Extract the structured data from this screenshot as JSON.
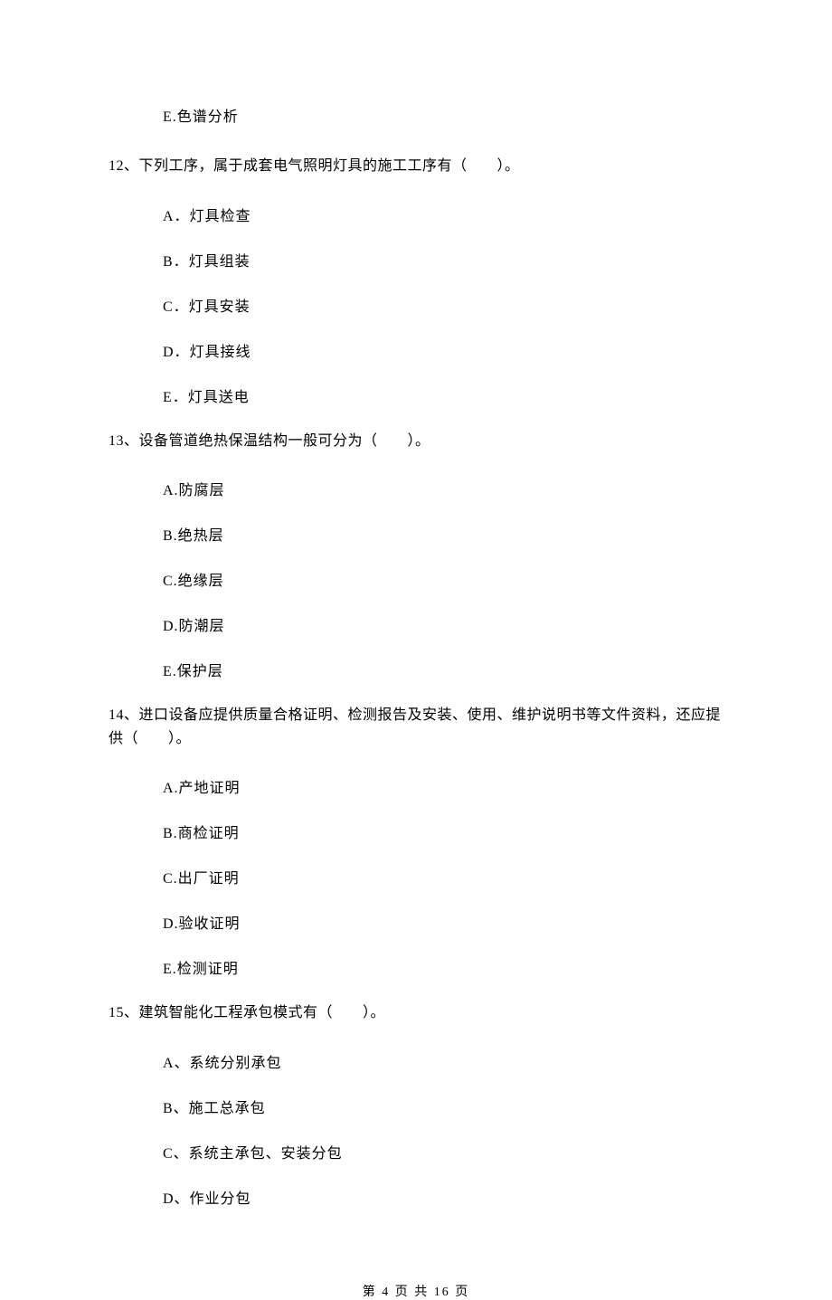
{
  "leftover": {
    "e": "E.色谱分析"
  },
  "q12": {
    "stem": "12、下列工序，属于成套电气照明灯具的施工工序有（　　）。",
    "a": "A．灯具检查",
    "b": "B．灯具组装",
    "c": "C．灯具安装",
    "d": "D．灯具接线",
    "e": "E．灯具送电"
  },
  "q13": {
    "stem": "13、设备管道绝热保温结构一般可分为（　　）。",
    "a": "A.防腐层",
    "b": "B.绝热层",
    "c": "C.绝缘层",
    "d": "D.防潮层",
    "e": "E.保护层"
  },
  "q14": {
    "stem": "14、进口设备应提供质量合格证明、检测报告及安装、使用、维护说明书等文件资料，还应提供（　　）。",
    "a": "A.产地证明",
    "b": "B.商检证明",
    "c": "C.出厂证明",
    "d": "D.验收证明",
    "e": "E.检测证明"
  },
  "q15": {
    "stem": "15、建筑智能化工程承包模式有（　　）。",
    "a": "A、系统分别承包",
    "b": "B、施工总承包",
    "c": "C、系统主承包、安装分包",
    "d": "D、作业分包"
  },
  "footer": "第 4 页 共 16 页"
}
